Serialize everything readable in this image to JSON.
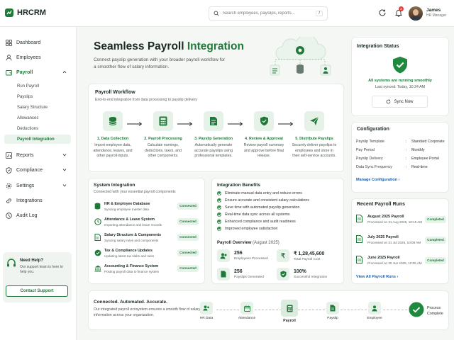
{
  "app": {
    "name": "HRCRM"
  },
  "search": {
    "placeholder": "Search employees, payslips, reports...",
    "shortcut": "/"
  },
  "notifications": {
    "count": "3"
  },
  "user": {
    "name": "James",
    "role": "HR Manager"
  },
  "sidebar": {
    "items": [
      {
        "label": "Dashboard",
        "icon": "grid-icon"
      },
      {
        "label": "Employees",
        "icon": "user-icon"
      },
      {
        "label": "Payroll",
        "icon": "wallet-icon"
      },
      {
        "label": "Reports",
        "icon": "chart-icon"
      },
      {
        "label": "Compliance",
        "icon": "shield-icon"
      },
      {
        "label": "Settings",
        "icon": "gear-icon"
      },
      {
        "label": "Integrations",
        "icon": "link-icon"
      },
      {
        "label": "Audit Log",
        "icon": "clock-icon"
      }
    ],
    "payroll_sub": [
      "Run Payroll",
      "Payslips",
      "Salary Structure",
      "Allowances",
      "Deductions",
      "Payroll Integration"
    ],
    "help": {
      "title": "Need Help?",
      "desc": "Our support team is here to help you.",
      "button": "Contact Support"
    }
  },
  "hero": {
    "title_a": "Seamless Payroll ",
    "title_b": "Integration",
    "desc": "Connect payslip generation with your broader payroll workflow for a smoother flow of salary information."
  },
  "workflow": {
    "title": "Payroll Workflow",
    "subtitle": "End-to-end integration from data processing to payslip delivery",
    "steps": [
      {
        "title": "1. Data Collection",
        "desc": "Import employee data, attendance, leaves, and other payroll inputs."
      },
      {
        "title": "2. Payroll Processing",
        "desc": "Calculate earnings, deductions, taxes, and other components."
      },
      {
        "title": "3. Payslip Generation",
        "desc": "Automatically generate accurate payslips using professional templates."
      },
      {
        "title": "4. Review & Approval",
        "desc": "Review payroll summary and approve before final release."
      },
      {
        "title": "5. Distribute Payslips",
        "desc": "Securely deliver payslips to employees and store in their self-service accounts."
      }
    ]
  },
  "system_integration": {
    "title": "System Integration",
    "subtitle": "Connected with your essential payroll components",
    "items": [
      {
        "title": "HR & Employee Database",
        "desc": "Syncing employee master data",
        "status": "Connected"
      },
      {
        "title": "Attendance & Leave System",
        "desc": "Importing attendance and leave records",
        "status": "Connected"
      },
      {
        "title": "Salary Structure & Components",
        "desc": "Syncing salary rules and components",
        "status": "Connected"
      },
      {
        "title": "Tax & Compliance Updates",
        "desc": "Updating latest tax slabs and rules",
        "status": "Connected"
      },
      {
        "title": "Accounting & Finance System",
        "desc": "Posting payroll data to finance system",
        "status": "Connected"
      }
    ]
  },
  "benefits": {
    "title": "Integration Benefits",
    "items": [
      "Eliminate manual data entry and reduce errors",
      "Ensure accurate and consistent salary calculations",
      "Save time with automated payslip generation",
      "Real-time data sync across all systems",
      "Enhanced compliance and audit readiness",
      "Improved employee satisfaction"
    ]
  },
  "overview": {
    "title": "Payroll Overview",
    "period": "(August 2025)",
    "stats": [
      {
        "value": "256",
        "label": "Employees Processed"
      },
      {
        "value": "₹ 1,28,45,600",
        "label": "Total Payroll Cost"
      },
      {
        "value": "256",
        "label": "Payslips Generated"
      },
      {
        "value": "100%",
        "label": "Successful Integration"
      }
    ]
  },
  "status": {
    "title": "Integration Status",
    "message": "All systems are running smoothly",
    "last_synced": "Last synced: Today, 10:24 AM",
    "button": "Sync Now"
  },
  "configuration": {
    "title": "Configuration",
    "rows": [
      {
        "key": "Payslip Template",
        "value": "Standard Corporate"
      },
      {
        "key": "Pay Period",
        "value": "Monthly"
      },
      {
        "key": "Payslip Delivery",
        "value": "Employee Portal"
      },
      {
        "key": "Data Sync Frequency",
        "value": "Real-time"
      }
    ],
    "link": "Manage Configuration"
  },
  "recent_runs": {
    "title": "Recent Payroll Runs",
    "items": [
      {
        "title": "August 2025 Payroll",
        "desc": "Processed on 31 Aug 2025, 10:15 AM",
        "status": "Completed"
      },
      {
        "title": "July 2025 Payroll",
        "desc": "Processed on 31 Jul 2025, 10:08 AM",
        "status": "Completed"
      },
      {
        "title": "June 2025 Payroll",
        "desc": "Processed on 30 Jun 2025, 10:05 AM",
        "status": "Completed"
      }
    ],
    "link": "View All Payroll Runs"
  },
  "flow": {
    "title": "Connected. Automated. Accurate.",
    "desc": "Our integrated payroll ecosystem ensures a smooth flow of salary information across your organization.",
    "nodes": [
      "HR Data",
      "Attendance",
      "Payroll",
      "Payslip",
      "Employee"
    ],
    "end": "Process Complete"
  },
  "colors": {
    "accent": "#1f7a3a",
    "accent_light": "#e6f1e8",
    "link": "#1f5fa8",
    "badge": "#e23b3b"
  }
}
